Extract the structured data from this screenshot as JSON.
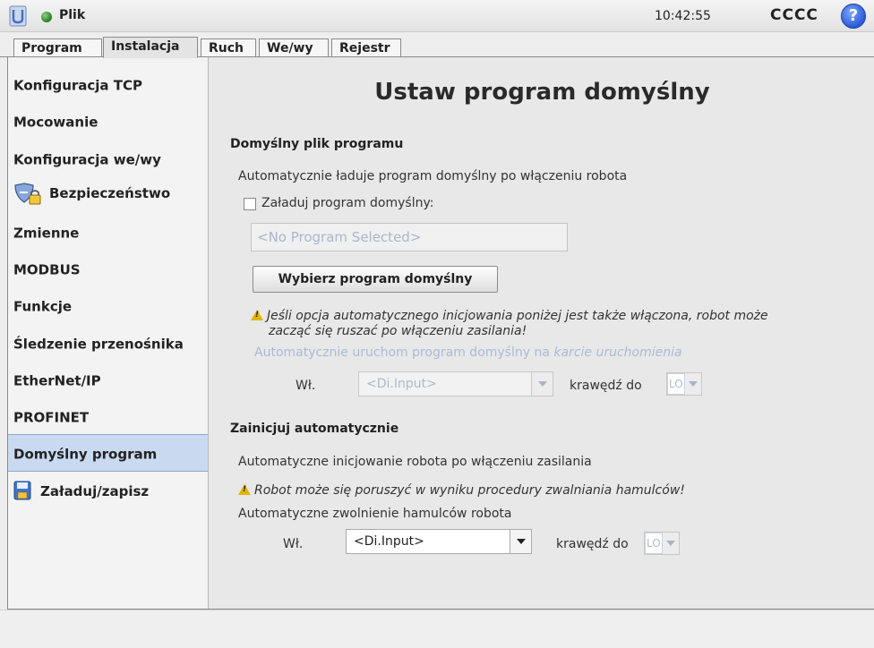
{
  "header": {
    "file_label": "Plik",
    "time": "10:42:55",
    "robot_name": "CCCC",
    "help_label": "?"
  },
  "tabs": [
    {
      "label": "Program",
      "active": false
    },
    {
      "label": "Instalacja",
      "active": true
    },
    {
      "label": "Ruch",
      "active": false
    },
    {
      "label": "We/wy",
      "active": false
    },
    {
      "label": "Rejestr",
      "active": false
    }
  ],
  "sidebar": {
    "items": [
      {
        "label": "Konfiguracja TCP"
      },
      {
        "label": "Mocowanie"
      },
      {
        "label": "Konfiguracja we/wy"
      },
      {
        "label": "Bezpieczeństwo"
      },
      {
        "label": "Zmienne"
      },
      {
        "label": "MODBUS"
      },
      {
        "label": "Funkcje"
      },
      {
        "label": "Śledzenie przenośnika"
      },
      {
        "label": "EtherNet/IP"
      },
      {
        "label": "PROFINET"
      },
      {
        "label": "Domyślny program"
      },
      {
        "label": "Załaduj/zapisz"
      }
    ],
    "active_index": 10
  },
  "main": {
    "title": "Ustaw program domyślny",
    "default_file": {
      "section_title": "Domyślny plik programu",
      "description": "Automatycznie ładuje program domyślny po włączeniu robota",
      "checkbox_label": "Załaduj program domyślny:",
      "checkbox_checked": false,
      "program_field_placeholder": "<No Program Selected>",
      "select_button": "Wybierz program domyślny",
      "warning_line1": "Jeśli opcja automatycznego inicjowania poniżej jest także włączona, robot może",
      "warning_line2": "zacząć się ruszać po włączeniu zasilania!",
      "autostart_text": "Automatycznie uruchom program domyślny na ",
      "autostart_italic": "karcie uruchomienia",
      "input_label": "Wł.",
      "input_value": "<Di.Input>",
      "edge_label": "krawędź do",
      "edge_value": "LO"
    },
    "auto_init": {
      "section_title": "Zainicjuj automatycznie",
      "description": "Automatyczne inicjowanie robota po włączeniu zasilania",
      "warning": "Robot może się poruszyć w wyniku procedury zwalniania hamulców!",
      "release_label": "Automatyczne zwolnienie hamulców robota",
      "input_label": "Wł.",
      "input_value": "<Di.Input>",
      "edge_label": "krawędź do",
      "edge_value": "LO"
    }
  },
  "colors": {
    "active_sidebar": "#c9daf0",
    "disabled_text": "#a8bad6",
    "warning": "#e0b400"
  }
}
